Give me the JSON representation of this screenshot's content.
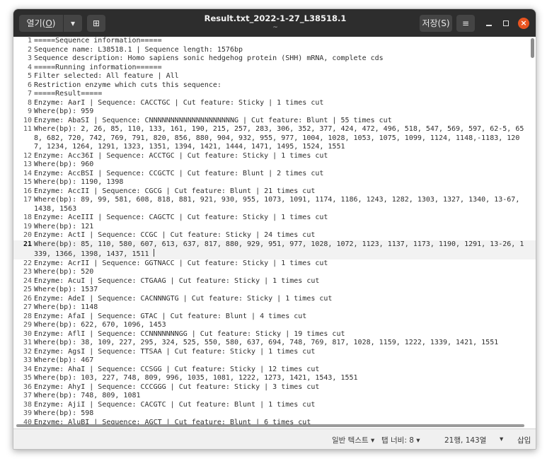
{
  "window": {
    "title": "Result.txt_2022-1-27_L38518.1",
    "subtitle": "~",
    "open_label_prefix": "열기(",
    "open_label_key": "O",
    "open_label_suffix": ")",
    "open_menu_icon": "▾",
    "new_tab_icon": "⊞",
    "save_label": "저장(S)",
    "menu_icon": "≡",
    "close_icon": "×"
  },
  "editor": {
    "current_line": 21,
    "lines": [
      {
        "n": "1",
        "t": "=====Sequence information====="
      },
      {
        "n": "2",
        "t": "Sequence name: L38518.1 | Sequence length: 1576bp"
      },
      {
        "n": "3",
        "t": "Sequence description: Homo sapiens sonic hedgehog protein (SHH) mRNA, complete cds"
      },
      {
        "n": "4",
        "t": "=====Running information======"
      },
      {
        "n": "5",
        "t": "Filter selected: All feature | All"
      },
      {
        "n": "6",
        "t": "Restriction enzyme which cuts this sequence:"
      },
      {
        "n": "7",
        "t": "=====Result====="
      },
      {
        "n": "8",
        "t": "Enzyme: AarI | Sequence: CACCTGC | Cut feature: Sticky | 1 times cut"
      },
      {
        "n": "9",
        "t": "Where(bp): 959"
      },
      {
        "n": "10",
        "t": "Enzyme: AbaSI | Sequence: CNNNNNNNNNNNNNNNNNNNNG | Cut feature: Blunt | 55 times cut"
      },
      {
        "n": "11",
        "t": "Where(bp): 2, 26, 85, 110, 133, 161, 190, 215, 257, 283, 306, 352, 377, 424, 472, 496, 518, 547, 569, 597, 62-5, 658, 682, 720, 742, 769, 791, 820, 856, 880, 904, 932, 955, 977, 1004, 1028, 1053, 1075, 1099, 1124, 1148,-1183, 1207, 1234, 1264, 1291, 1323, 1351, 1394, 1421, 1444, 1471, 1495, 1524, 1551"
      },
      {
        "n": "12",
        "t": "Enzyme: Acc36I | Sequence: ACCTGC | Cut feature: Sticky | 1 times cut"
      },
      {
        "n": "13",
        "t": "Where(bp): 960"
      },
      {
        "n": "14",
        "t": "Enzyme: AccBSI | Sequence: CCGCTC | Cut feature: Blunt | 2 times cut"
      },
      {
        "n": "15",
        "t": "Where(bp): 1190, 1398"
      },
      {
        "n": "16",
        "t": "Enzyme: AccII | Sequence: CGCG | Cut feature: Blunt | 21 times cut"
      },
      {
        "n": "17",
        "t": "Where(bp): 89, 99, 581, 608, 818, 881, 921, 930, 955, 1073, 1091, 1174, 1186, 1243, 1282, 1303, 1327, 1340, 13-67, 1438, 1563"
      },
      {
        "n": "18",
        "t": "Enzyme: AceIII | Sequence: CAGCTC | Cut feature: Sticky | 1 times cut"
      },
      {
        "n": "19",
        "t": "Where(bp): 121"
      },
      {
        "n": "20",
        "t": "Enzyme: ActI | Sequence: CCGC | Cut feature: Sticky | 24 times cut"
      },
      {
        "n": "21",
        "t": "Where(bp): 85, 110, 580, 607, 613, 637, 817, 880, 929, 951, 977, 1028, 1072, 1123, 1137, 1173, 1190, 1291, 13-26, 1339, 1366, 1398, 1437, 1511 "
      },
      {
        "n": "22",
        "t": "Enzyme: AcrII | Sequence: GGTNACC | Cut feature: Sticky | 1 times cut"
      },
      {
        "n": "23",
        "t": "Where(bp): 520"
      },
      {
        "n": "24",
        "t": "Enzyme: AcuI | Sequence: CTGAAG | Cut feature: Sticky | 1 times cut"
      },
      {
        "n": "25",
        "t": "Where(bp): 1537"
      },
      {
        "n": "26",
        "t": "Enzyme: AdeI | Sequence: CACNNNGTG | Cut feature: Sticky | 1 times cut"
      },
      {
        "n": "27",
        "t": "Where(bp): 1148"
      },
      {
        "n": "28",
        "t": "Enzyme: AfaI | Sequence: GTAC | Cut feature: Blunt | 4 times cut"
      },
      {
        "n": "29",
        "t": "Where(bp): 622, 670, 1096, 1453"
      },
      {
        "n": "30",
        "t": "Enzyme: AflI | Sequence: CCNNNNNNNGG | Cut feature: Sticky | 19 times cut"
      },
      {
        "n": "31",
        "t": "Where(bp): 38, 109, 227, 295, 324, 525, 550, 580, 637, 694, 748, 769, 817, 1028, 1159, 1222, 1339, 1421, 1551"
      },
      {
        "n": "32",
        "t": "Enzyme: AgsI | Sequence: TTSAA | Cut feature: Sticky | 1 times cut"
      },
      {
        "n": "33",
        "t": "Where(bp): 467"
      },
      {
        "n": "34",
        "t": "Enzyme: AhaI | Sequence: CCSGG | Cut feature: Sticky | 12 times cut"
      },
      {
        "n": "35",
        "t": "Where(bp): 103, 227, 748, 809, 996, 1035, 1081, 1222, 1273, 1421, 1543, 1551"
      },
      {
        "n": "36",
        "t": "Enzyme: AhyI | Sequence: CCCGGG | Cut feature: Sticky | 3 times cut"
      },
      {
        "n": "37",
        "t": "Where(bp): 748, 809, 1081"
      },
      {
        "n": "38",
        "t": "Enzyme: AjiI | Sequence: CACGTC | Cut feature: Blunt | 1 times cut"
      },
      {
        "n": "39",
        "t": "Where(bp): 598"
      },
      {
        "n": "40",
        "t": "Enzyme: AluBI | Sequence: AGCT | Cut feature: Blunt | 6 times cut"
      }
    ]
  },
  "statusbar": {
    "syntax": "일반 텍스트 ▾",
    "tab_width": "탭 너비: 8 ▾",
    "position": "21행, 143열",
    "position_arrow": "▾",
    "insert_mode": "삽입"
  },
  "colors": {
    "headerbar": "#2d2d2d",
    "close_button": "#e95420",
    "current_line_bg": "#f2f2f2",
    "statusbar_bg": "#f0f0f0"
  }
}
